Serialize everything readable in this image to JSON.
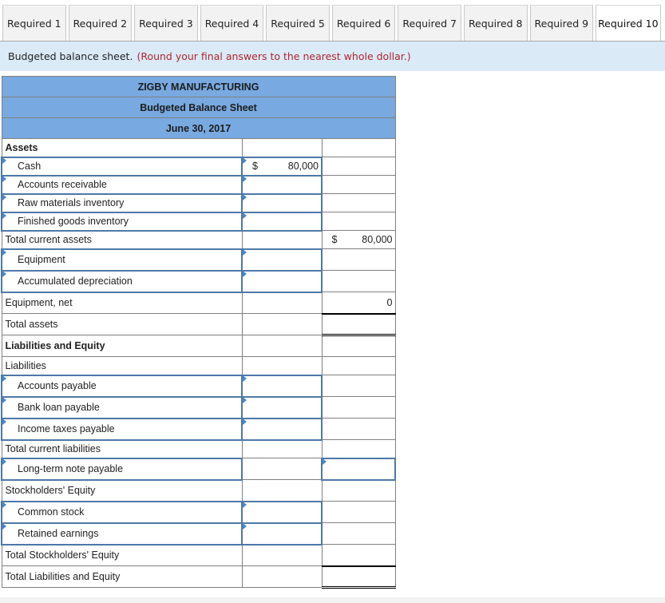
{
  "tabs": [
    {
      "label": "Required 1",
      "active": false
    },
    {
      "label": "Required 2",
      "active": false
    },
    {
      "label": "Required 3",
      "active": false
    },
    {
      "label": "Required 4",
      "active": false
    },
    {
      "label": "Required 5",
      "active": false
    },
    {
      "label": "Required 6",
      "active": false
    },
    {
      "label": "Required 7",
      "active": false
    },
    {
      "label": "Required 8",
      "active": false
    },
    {
      "label": "Required 9",
      "active": false
    },
    {
      "label": "Required 10",
      "active": true
    }
  ],
  "instruction": {
    "text": "Budgeted balance sheet.",
    "hint": "(Round your final answers to the nearest whole dollar.)"
  },
  "sheet": {
    "company": "ZIGBY MANUFACTURING",
    "title": "Budgeted Balance Sheet",
    "date": "June 30, 2017",
    "currency_symbol": "$",
    "rows": {
      "assets": "Assets",
      "cash": {
        "label": "Cash",
        "value": "80,000"
      },
      "accounts_receivable": {
        "label": "Accounts receivable",
        "value": ""
      },
      "raw_materials": {
        "label": "Raw materials inventory",
        "value": ""
      },
      "finished_goods": {
        "label": "Finished goods inventory",
        "value": ""
      },
      "total_current_assets": {
        "label": "Total current assets",
        "value": "80,000"
      },
      "equipment": {
        "label": "Equipment",
        "value": ""
      },
      "accumulated_depreciation": {
        "label": "Accumulated depreciation",
        "value": ""
      },
      "equipment_net": {
        "label": "Equipment, net",
        "value": "0"
      },
      "total_assets": {
        "label": "Total assets",
        "value": ""
      },
      "liabilities_and_equity": "Liabilities and Equity",
      "liabilities": "Liabilities",
      "accounts_payable": {
        "label": "Accounts payable",
        "value": ""
      },
      "bank_loan_payable": {
        "label": "Bank loan payable",
        "value": ""
      },
      "income_taxes_payable": {
        "label": "Income taxes payable",
        "value": ""
      },
      "total_current_liabilities": {
        "label": "Total current liabilities",
        "value": ""
      },
      "long_term_note_payable": {
        "label": "Long-term note payable",
        "value": ""
      },
      "stockholders_equity": "Stockholders' Equity",
      "common_stock": {
        "label": "Common stock",
        "value": ""
      },
      "retained_earnings": {
        "label": "Retained earnings",
        "value": ""
      },
      "total_stockholders_equity": {
        "label": "Total Stockholders' Equity",
        "value": ""
      },
      "total_liabilities_and_equity": {
        "label": "Total Liabilities and Equity",
        "value": ""
      }
    }
  }
}
